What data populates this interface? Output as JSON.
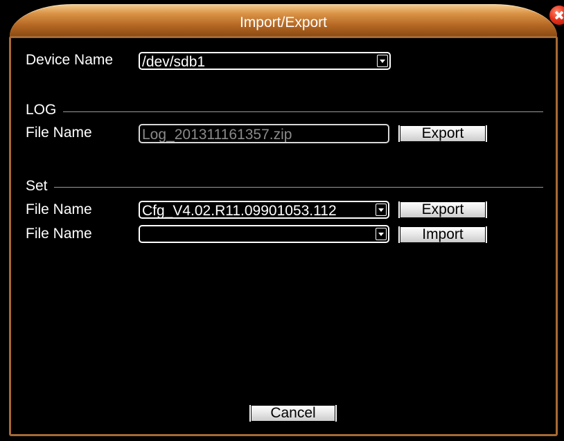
{
  "window": {
    "title": "Import/Export"
  },
  "device": {
    "label": "Device Name",
    "value": "/dev/sdb1"
  },
  "log": {
    "section_title": "LOG",
    "file_label": "File Name",
    "file_value": "Log_201311161357.zip",
    "export_label": "Export"
  },
  "set": {
    "section_title": "Set",
    "export_file_label": "File Name",
    "export_file_value": "Cfg_V4.02.R11.09901053.112",
    "export_label": "Export",
    "import_file_label": "File Name",
    "import_file_value": "",
    "import_label": "Import"
  },
  "footer": {
    "cancel_label": "Cancel"
  },
  "colors": {
    "title_bar": "#c07a35",
    "panel_border": "#a86a33",
    "close_button": "#e8341c",
    "background": "#000000"
  },
  "icons": [
    "close-icon",
    "dropdown-arrow-icon"
  ]
}
